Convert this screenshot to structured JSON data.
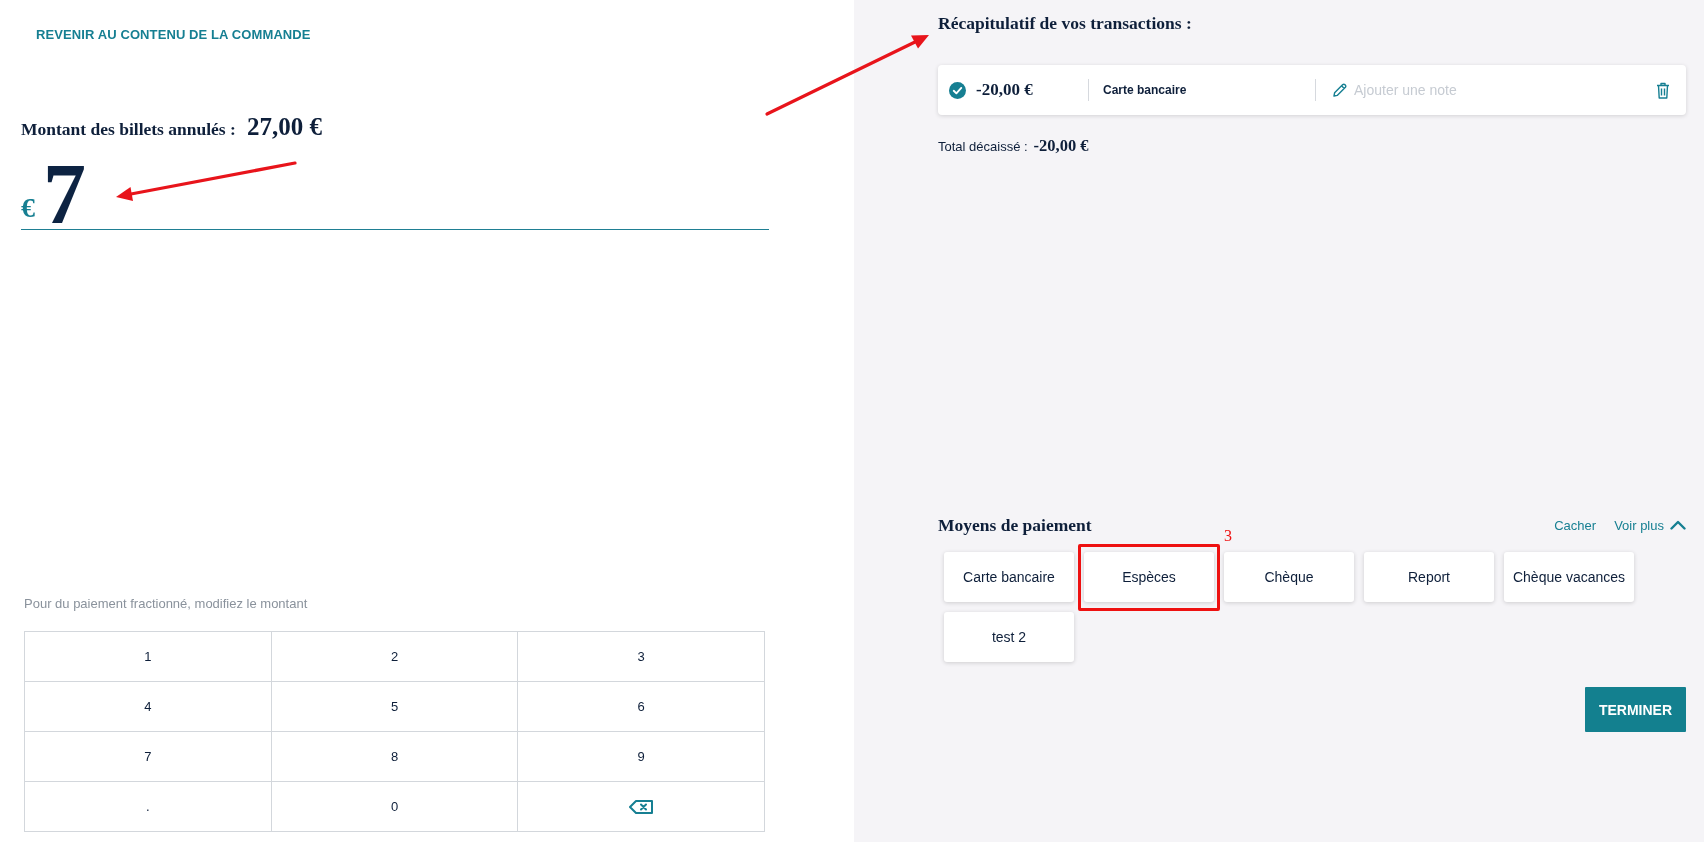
{
  "back_link": {
    "label": "REVENIR AU CONTENU DE LA COMMANDE"
  },
  "cancelled_amount": {
    "label": "Montant des billets annulés :",
    "value": "27,00 €"
  },
  "amount_field": {
    "currency": "€",
    "value": "7"
  },
  "split_hint": "Pour du paiement fractionné, modifiez le montant",
  "keypad": [
    {
      "kind": "digit",
      "label": "1"
    },
    {
      "kind": "digit",
      "label": "2"
    },
    {
      "kind": "digit",
      "label": "3"
    },
    {
      "kind": "digit",
      "label": "4"
    },
    {
      "kind": "digit",
      "label": "5"
    },
    {
      "kind": "digit",
      "label": "6"
    },
    {
      "kind": "digit",
      "label": "7"
    },
    {
      "kind": "digit",
      "label": "8"
    },
    {
      "kind": "digit",
      "label": "9"
    },
    {
      "kind": "digit",
      "label": "."
    },
    {
      "kind": "digit",
      "label": "0"
    },
    {
      "kind": "backspace"
    }
  ],
  "summary": {
    "title": "Récapitulatif de vos transactions :",
    "transactions": [
      {
        "confirmed": true,
        "amount": "-20,00 €",
        "method": "Carte bancaire",
        "note": {
          "placeholder": "Ajouter une note"
        }
      }
    ],
    "total": {
      "label": "Total décaissé :",
      "value": "-20,00 €"
    }
  },
  "payment_methods": {
    "title": "Moyens de paiement",
    "hide_link": "Cacher",
    "more_link": {
      "label": "Voir plus",
      "expanded": true
    },
    "methods": [
      {
        "label": "Carte bancaire",
        "highlighted": false
      },
      {
        "label": "Espèces",
        "highlighted": true,
        "callout": "3"
      },
      {
        "label": "Chèque",
        "highlighted": false
      },
      {
        "label": "Report",
        "highlighted": false
      },
      {
        "label": "Chèque vacances",
        "highlighted": false
      },
      {
        "label": "test 2",
        "highlighted": false
      }
    ]
  },
  "finish_button": "TERMINER"
}
